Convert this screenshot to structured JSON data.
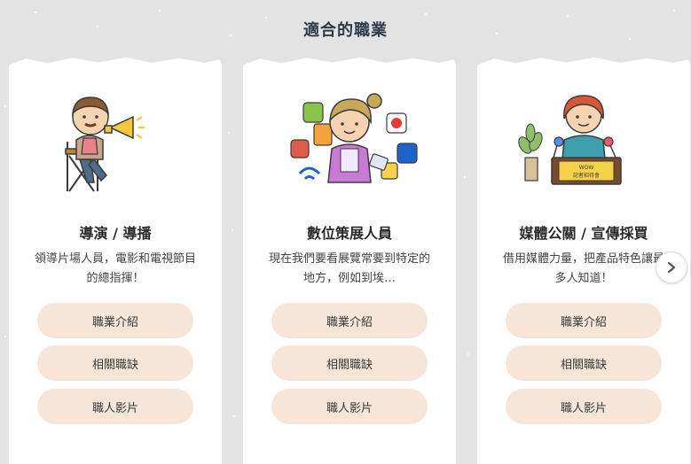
{
  "section": {
    "title": "適合的職業"
  },
  "cards": [
    {
      "title": "導演 / 導播",
      "description": "領導片場人員，電影和電視節目的總指揮！",
      "buttons": [
        "職業介紹",
        "相關職缺",
        "職人影片"
      ]
    },
    {
      "title": "數位策展人員",
      "description": "現在我們要看展覽常要到特定的地方，例如到埃…",
      "buttons": [
        "職業介紹",
        "相關職缺",
        "職人影片"
      ]
    },
    {
      "title": "媒體公關 / 宣傳採買",
      "description": "借用媒體力量，把產品特色讓最多人知道！",
      "buttons": [
        "職業介紹",
        "相關職缺",
        "職人影片"
      ],
      "illustration_sign": {
        "line1": "WOW",
        "line2": "記者招待會"
      }
    }
  ],
  "carousel": {
    "next_icon": "chevron-right-icon"
  },
  "colors": {
    "background": "#e3e3e4",
    "card": "#ffffff",
    "button_bg": "#f7e6d7",
    "title": "#2e3a4a"
  }
}
